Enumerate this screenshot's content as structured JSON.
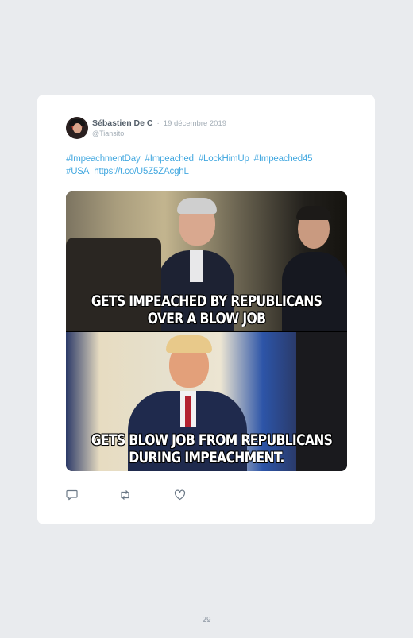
{
  "tweet": {
    "author_name": "Sébastien De C",
    "separator": "·",
    "date": "19 décembre 2019",
    "handle": "@Tiansito",
    "text_parts": [
      "#ImpeachmentDay",
      "#Impeached",
      "#LockHimUp",
      "#Impeached45",
      "#USA",
      "https://t.co/U5Z5ZAcghL"
    ],
    "media": {
      "top_caption_line1": "GETS IMPEACHED BY REPUBLICANS",
      "top_caption_line2": "OVER A BLOW JOB",
      "bottom_caption_line1": "GETS BLOW JOB FROM REPUBLICANS",
      "bottom_caption_line2": "DURING IMPEACHMENT."
    },
    "actions": {
      "reply_icon": "comment-icon",
      "retweet_icon": "retweet-icon",
      "like_icon": "heart-icon"
    }
  },
  "page": {
    "number": "29"
  },
  "colors": {
    "background": "#e9ebee",
    "card": "#ffffff",
    "link": "#45a9e0",
    "muted": "#a3adb6"
  }
}
